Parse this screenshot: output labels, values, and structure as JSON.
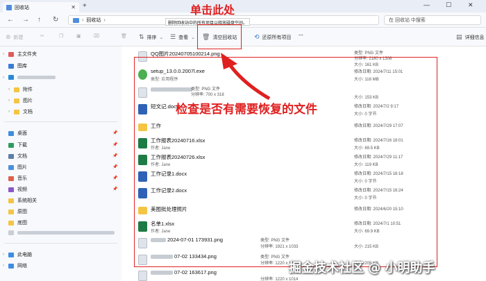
{
  "window": {
    "tab_title": "回收站",
    "tab_close": "✕",
    "new_tab": "+",
    "controls": {
      "minimize": "—",
      "maximize": "☐",
      "close": "✕"
    }
  },
  "address": {
    "back": "←",
    "forward": "→",
    "up": "↑",
    "refresh": "↻",
    "root_sep": "›",
    "location": "回收站",
    "location_sep": "›",
    "search_placeholder": "在 回收站 中搜索"
  },
  "toolbar": {
    "new_label": "新建",
    "sort_label": "排序",
    "view_label": "查看",
    "empty_bin_label": "清空回收站",
    "restore_all_label": "还原所有项目",
    "more_label": "···",
    "details_label": "详细信息",
    "tooltip": "删除回收站中的所有项目以释放磁盘空间。"
  },
  "sidebar": {
    "home": "主文件夹",
    "gallery": "图库",
    "folders": [
      "附件",
      "图片",
      "文档"
    ],
    "quick": [
      "桌面",
      "下载",
      "文档",
      "图片",
      "音乐",
      "视频",
      "系统相关",
      "原图",
      "底图"
    ],
    "this_pc": "此电脑",
    "network": "网络"
  },
  "files": [
    {
      "name": "QQ图片20240705100214.png",
      "icon": "png",
      "meta_a": "",
      "meta_b": "",
      "r1": "类型: PNG 文件",
      "r1b": "分辨率: 2180 x 1308",
      "r2": "大小: 161 KB"
    },
    {
      "name": "setup_13.0.0.2007l.exe",
      "icon": "exe",
      "meta_a": "类型: 应用程序",
      "r1": "修改日期: 2024/7/11 15:01",
      "r2": "大小: 116 MB"
    },
    {
      "name": "",
      "icon": "png",
      "meta_a": "类型: PNG 文件",
      "meta_b": "分辨率: 700 x 318",
      "r2": "大小: 153 KB"
    },
    {
      "name": "短文记.docx",
      "icon": "doc",
      "meta_a": "",
      "r1": "修改日期: 2024/7/2 9:17",
      "r2": "大小: 0 字节"
    },
    {
      "name": "工作",
      "icon": "folder",
      "meta_a": "",
      "r1": "修改日期: 2024/7/29 17:07",
      "r2": ""
    },
    {
      "name": "工作报表20240716.xlsx",
      "icon": "xls",
      "meta_a": "作者: Jane",
      "r1": "修改日期: 2024/7/16 18:01",
      "r2": "大小: 69.5 KB"
    },
    {
      "name": "工作报表20240726.xlsx",
      "icon": "xls",
      "meta_a": "作者: Jane",
      "r1": "修改日期: 2024/7/29 11:17",
      "r2": "大小: 119 KB"
    },
    {
      "name": "工作记录1.docx",
      "icon": "doc",
      "meta_a": "",
      "r1": "修改日期: 2024/7/15 16:18",
      "r2": "大小: 0 字节"
    },
    {
      "name": "工作记录2.docx",
      "icon": "doc",
      "meta_a": "",
      "r1": "修改日期: 2024/7/15 16:24",
      "r2": "大小: 0 字节"
    },
    {
      "name": "美图批处理照片",
      "icon": "folder",
      "meta_a": "",
      "r1": "修改日期: 2024/6/20 15:10",
      "r2": ""
    },
    {
      "name": "名单1.xlsx",
      "icon": "xls",
      "meta_a": "作者: Jane",
      "r1": "修改日期: 2024/7/1 10:51",
      "r2": "大小: 69.9 KB"
    },
    {
      "name": "2024-07-01 173931.png",
      "icon": "png",
      "meta_a": "",
      "r1": "类型: PNG 文件",
      "r1b": "分辨率: 1921 x 1033",
      "r2": "大小: 215 KB"
    },
    {
      "name": "07-02 133434.png",
      "icon": "png",
      "meta_a": "",
      "r1": "类型: PNG 文件",
      "r1b": "分辨率: 1220 x 1014",
      "r2": "大小: 205 KB"
    },
    {
      "name": "07-02 163617.png",
      "icon": "png",
      "meta_a": "",
      "r1": "分辨率: 1220 x 1014",
      "r2": ""
    }
  ],
  "annotations": {
    "top": "单击此处",
    "middle": "检查是否有需要恢复的文件",
    "accent": "#e02020"
  },
  "watermark": "掘金技术社区 @ 小明助手"
}
